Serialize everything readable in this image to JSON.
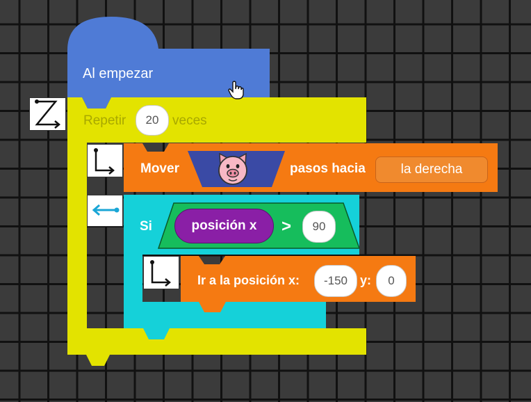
{
  "start_block": {
    "label": "Al empezar"
  },
  "repeat_block": {
    "label_before": "Repetir",
    "count": "20",
    "label_after": "veces"
  },
  "move_block": {
    "label": "Mover",
    "sprite_icon": "pig-face-icon",
    "label_direction": "pasos hacia",
    "direction_value": "la derecha"
  },
  "if_block": {
    "label": "Si",
    "variable": "posición x",
    "operator": ">",
    "value": "90"
  },
  "goto_block": {
    "label_x": "Ir a la posición x:",
    "x_value": "-150",
    "label_y": "y:",
    "y_value": "0"
  },
  "colors": {
    "start": "#4f7bd6",
    "repeat": "#e6e600",
    "move": "#f57a12",
    "if": "#15d1d9",
    "condition": "#16bd5c",
    "variable": "#8a1fa6",
    "goto": "#f57a12"
  }
}
